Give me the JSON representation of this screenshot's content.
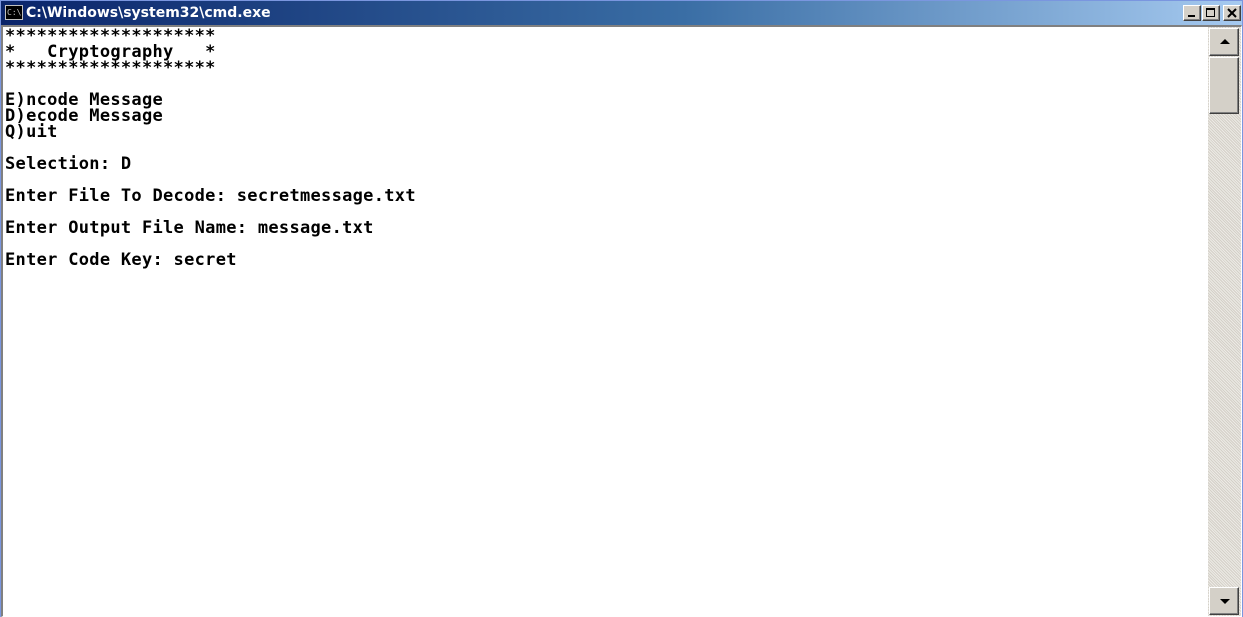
{
  "window": {
    "title": "C:\\Windows\\system32\\cmd.exe",
    "icon": "cmd-icon",
    "icon_text": "C:\\",
    "buttons": {
      "minimize": "minimize-icon",
      "maximize": "maximize-icon",
      "close": "close-icon"
    }
  },
  "console": {
    "lines": [
      "********************",
      "*   Cryptography   *",
      "********************",
      "",
      "E)ncode Message",
      "D)ecode Message",
      "Q)uit",
      "",
      "Selection: D",
      "",
      "Enter File To Decode: secretmessage.txt",
      "",
      "Enter Output File Name: message.txt",
      "",
      "Enter Code Key: secret"
    ]
  },
  "scrollbar": {
    "up_icon": "scroll-up-arrow-icon",
    "down_icon": "scroll-down-arrow-icon"
  },
  "colors": {
    "titlebar_start": "#0a246a",
    "titlebar_end": "#a6caf0",
    "console_bg": "#ffffff",
    "console_text": "#000000",
    "chrome": "#d4d0c8"
  }
}
